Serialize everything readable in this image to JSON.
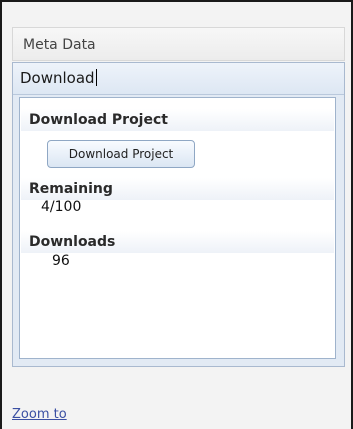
{
  "tabs": {
    "meta_data": "Meta Data",
    "download": "Download"
  },
  "download_project": {
    "heading": "Download Project",
    "button_label": "Download Project"
  },
  "remaining": {
    "heading": "Remaining",
    "value": "4/100"
  },
  "downloads": {
    "heading": "Downloads",
    "value": "96"
  },
  "footer": {
    "zoom_link": "Zoom to"
  }
}
